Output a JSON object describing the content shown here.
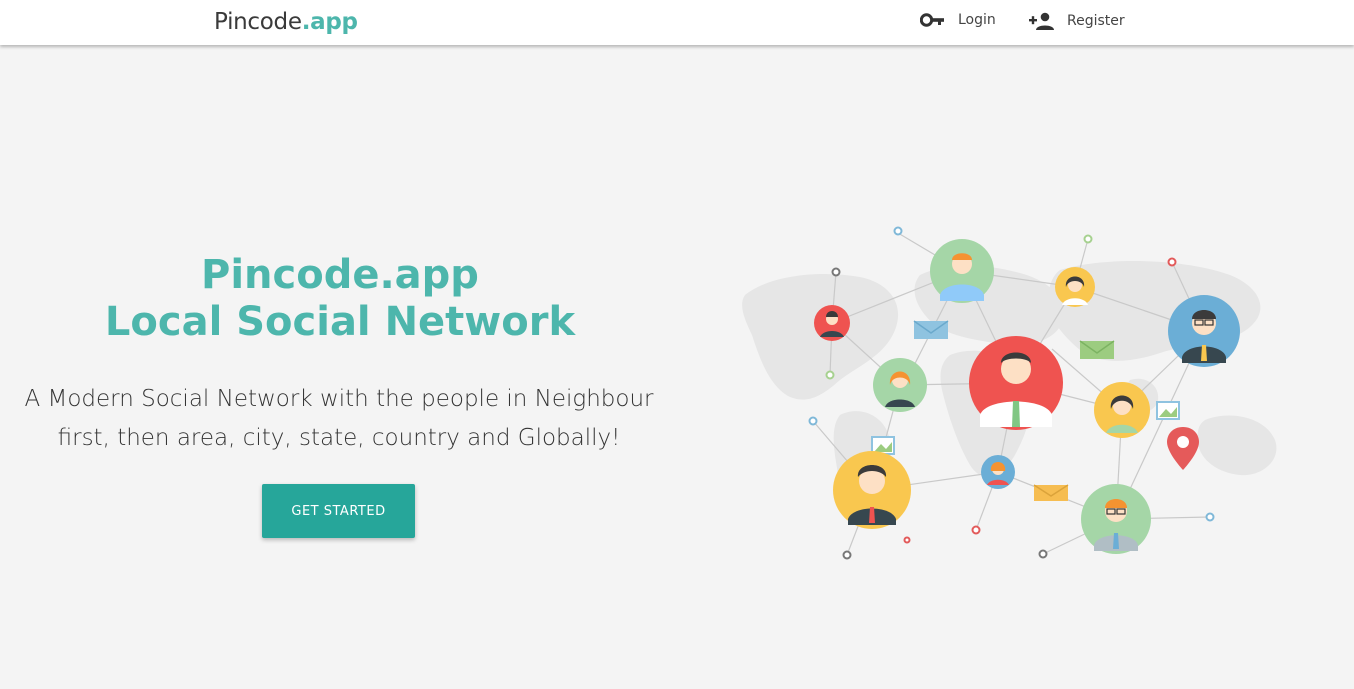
{
  "nav": {
    "brand_main": "Pincode",
    "brand_accent": ".app",
    "login_label": "Login",
    "register_label": "Register"
  },
  "hero": {
    "title_line1": "Pincode.app",
    "title_line2": "Local Social Network",
    "subtitle_line1": "A Modern Social Network with the people in Neighbour",
    "subtitle_line2": "first, then area, city, state, country and Globally!",
    "cta_label": "GET STARTED"
  },
  "colors": {
    "accent": "#4db6ac",
    "button": "#26a69a",
    "background": "#f4f4f4"
  },
  "icons": {
    "login": "key-icon",
    "register": "person-add-icon"
  }
}
